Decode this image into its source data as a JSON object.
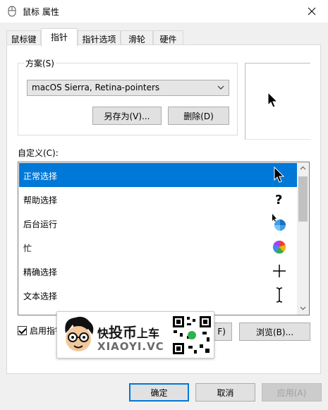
{
  "window": {
    "title": "鼠标 属性"
  },
  "tabs": [
    {
      "label": "鼠标键"
    },
    {
      "label": "指针"
    },
    {
      "label": "指针选项"
    },
    {
      "label": "滑轮"
    },
    {
      "label": "硬件"
    }
  ],
  "scheme": {
    "group_label": "方案(S)",
    "selected": "macOS Sierra, Retina-pointers",
    "save_as_label": "另存为(V)...",
    "delete_label": "删除(D)"
  },
  "custom": {
    "label": "自定义(C):",
    "items": [
      {
        "label": "正常选择",
        "icon": "arrow-pointer-icon"
      },
      {
        "label": "帮助选择",
        "icon": "help-cursor-icon"
      },
      {
        "label": "后台运行",
        "icon": "working-in-background-icon"
      },
      {
        "label": "忙",
        "icon": "busy-spinner-icon"
      },
      {
        "label": "精确选择",
        "icon": "crosshair-icon"
      },
      {
        "label": "文本选择",
        "icon": "text-ibeam-icon"
      }
    ]
  },
  "options": {
    "enable_shadow_label": "启用指针",
    "default_partial_label": "F)",
    "browse_label": "浏览(B)..."
  },
  "watermark": {
    "line1_a": "快",
    "line1_b": "投币",
    "line1_c": "上车",
    "line2": "XIAOYI.VC"
  },
  "footer": {
    "ok_label": "确定",
    "cancel_label": "取消",
    "apply_label": "应用(A)"
  },
  "colors": {
    "selection": "#0078d7",
    "accent": "#0078d7"
  }
}
